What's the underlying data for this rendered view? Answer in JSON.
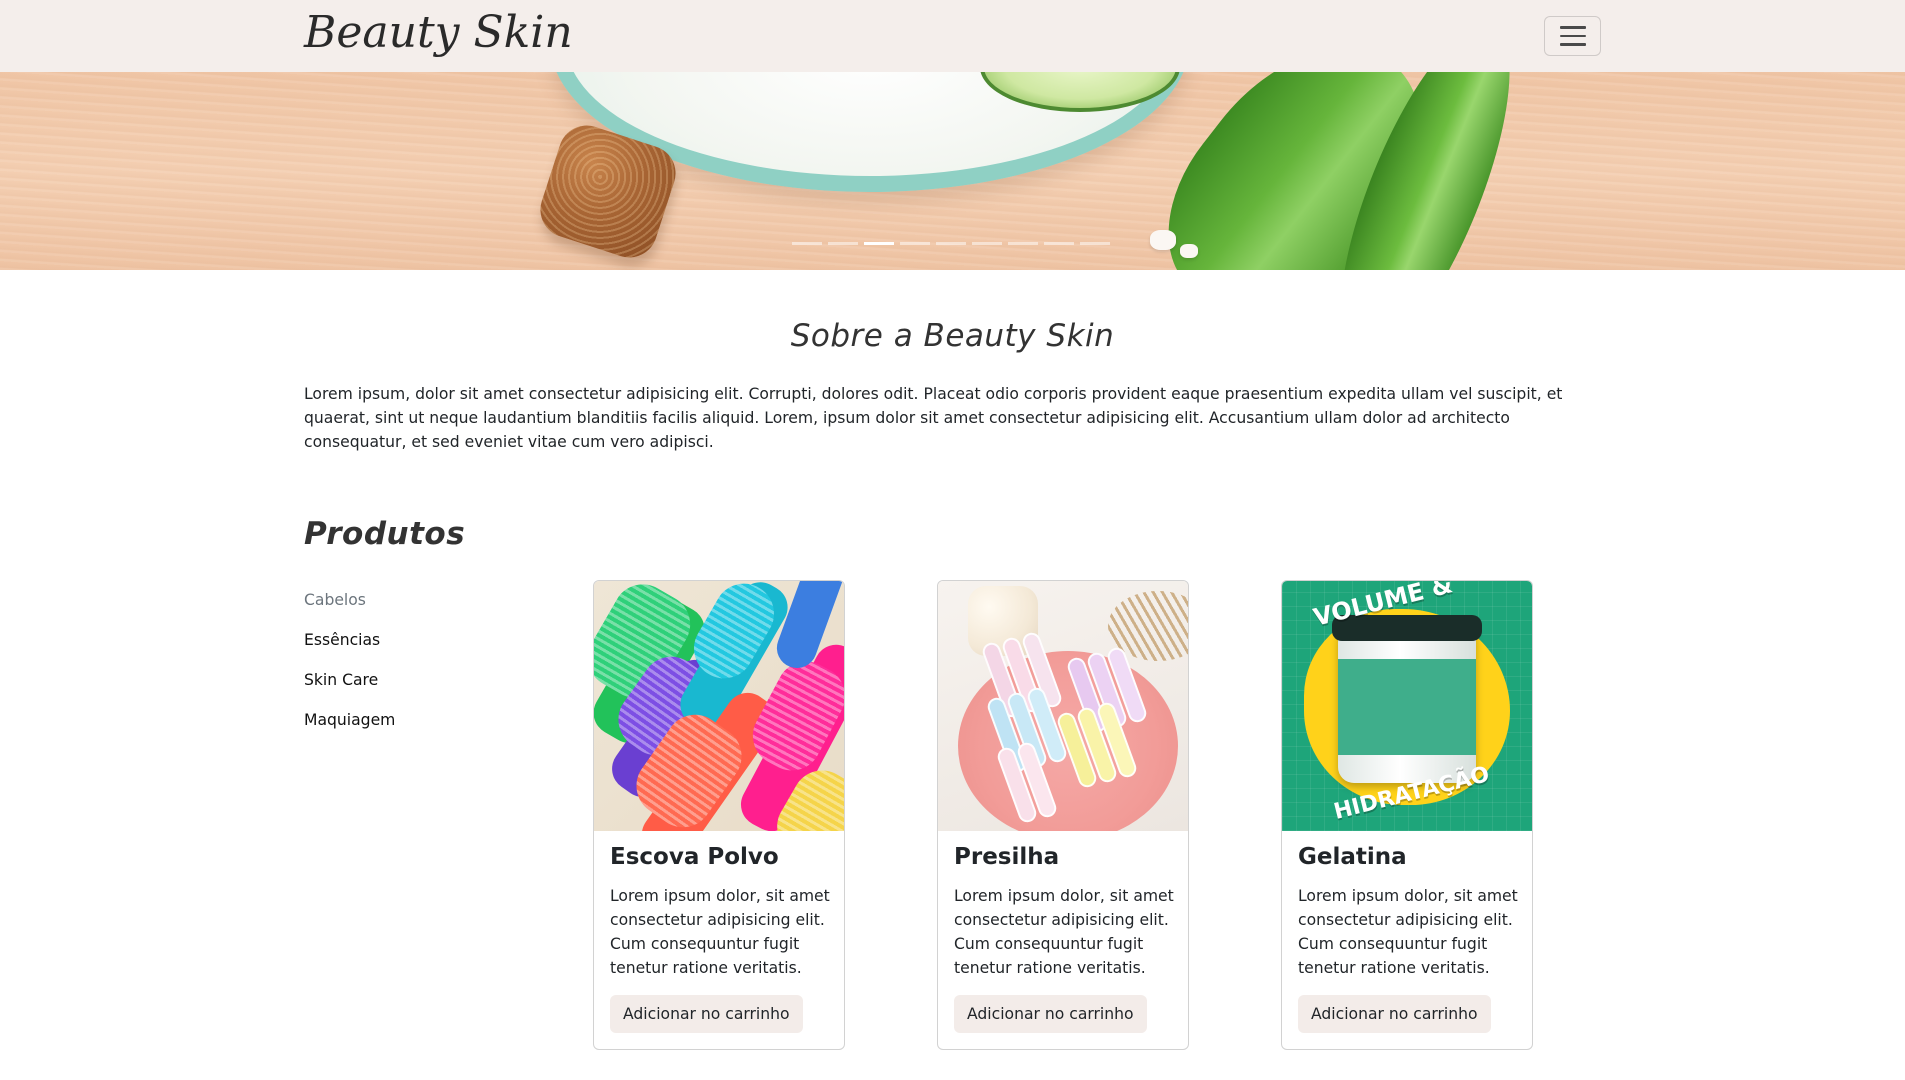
{
  "navbar": {
    "brand": "Beauty Skin",
    "toggler_icon": "hamburger-icon"
  },
  "hero": {
    "slide_count": 9,
    "active_slide": 3
  },
  "about": {
    "title": "Sobre a Beauty Skin",
    "text": "Lorem ipsum, dolor sit amet consectetur adipisicing elit. Corrupti, dolores odit. Placeat odio corporis provident eaque praesentium expedita ullam vel suscipit, et quaerat, sint ut neque laudantium blanditiis facilis aliquid. Lorem, ipsum dolor sit amet consectetur adipisicing elit. Accusantium ullam dolor ad architecto consequatur, et sed eveniet vitae cum vero adipisci."
  },
  "products": {
    "title": "Produtos",
    "categories": [
      {
        "label": "Cabelos",
        "active": true
      },
      {
        "label": "Essências",
        "active": false
      },
      {
        "label": "Skin Care",
        "active": false
      },
      {
        "label": "Maquiagem",
        "active": false
      }
    ],
    "cards": [
      {
        "title": "Escova Polvo",
        "text": "Lorem ipsum dolor, sit amet consectetur adipisicing elit. Cum consequuntur fugit tenetur ratione veritatis.",
        "button": "Adicionar no carrinho"
      },
      {
        "title": "Presilha",
        "text": "Lorem ipsum dolor, sit amet consectetur adipisicing elit. Cum consequuntur fugit tenetur ratione veritatis.",
        "button": "Adicionar no carrinho"
      },
      {
        "title": "Gelatina",
        "text": "Lorem ipsum dolor, sit amet consectetur adipisicing elit. Cum consequuntur fugit tenetur ratione veritatis.",
        "button": "Adicionar no carrinho",
        "image_text_top": "VOLUME &",
        "image_text_bottom": "HIDRATAÇÃO"
      }
    ]
  },
  "colors": {
    "navbar_bg": "#f4eeeb",
    "button_bg": "#f3ece9",
    "muted_link": "#6c757d"
  }
}
